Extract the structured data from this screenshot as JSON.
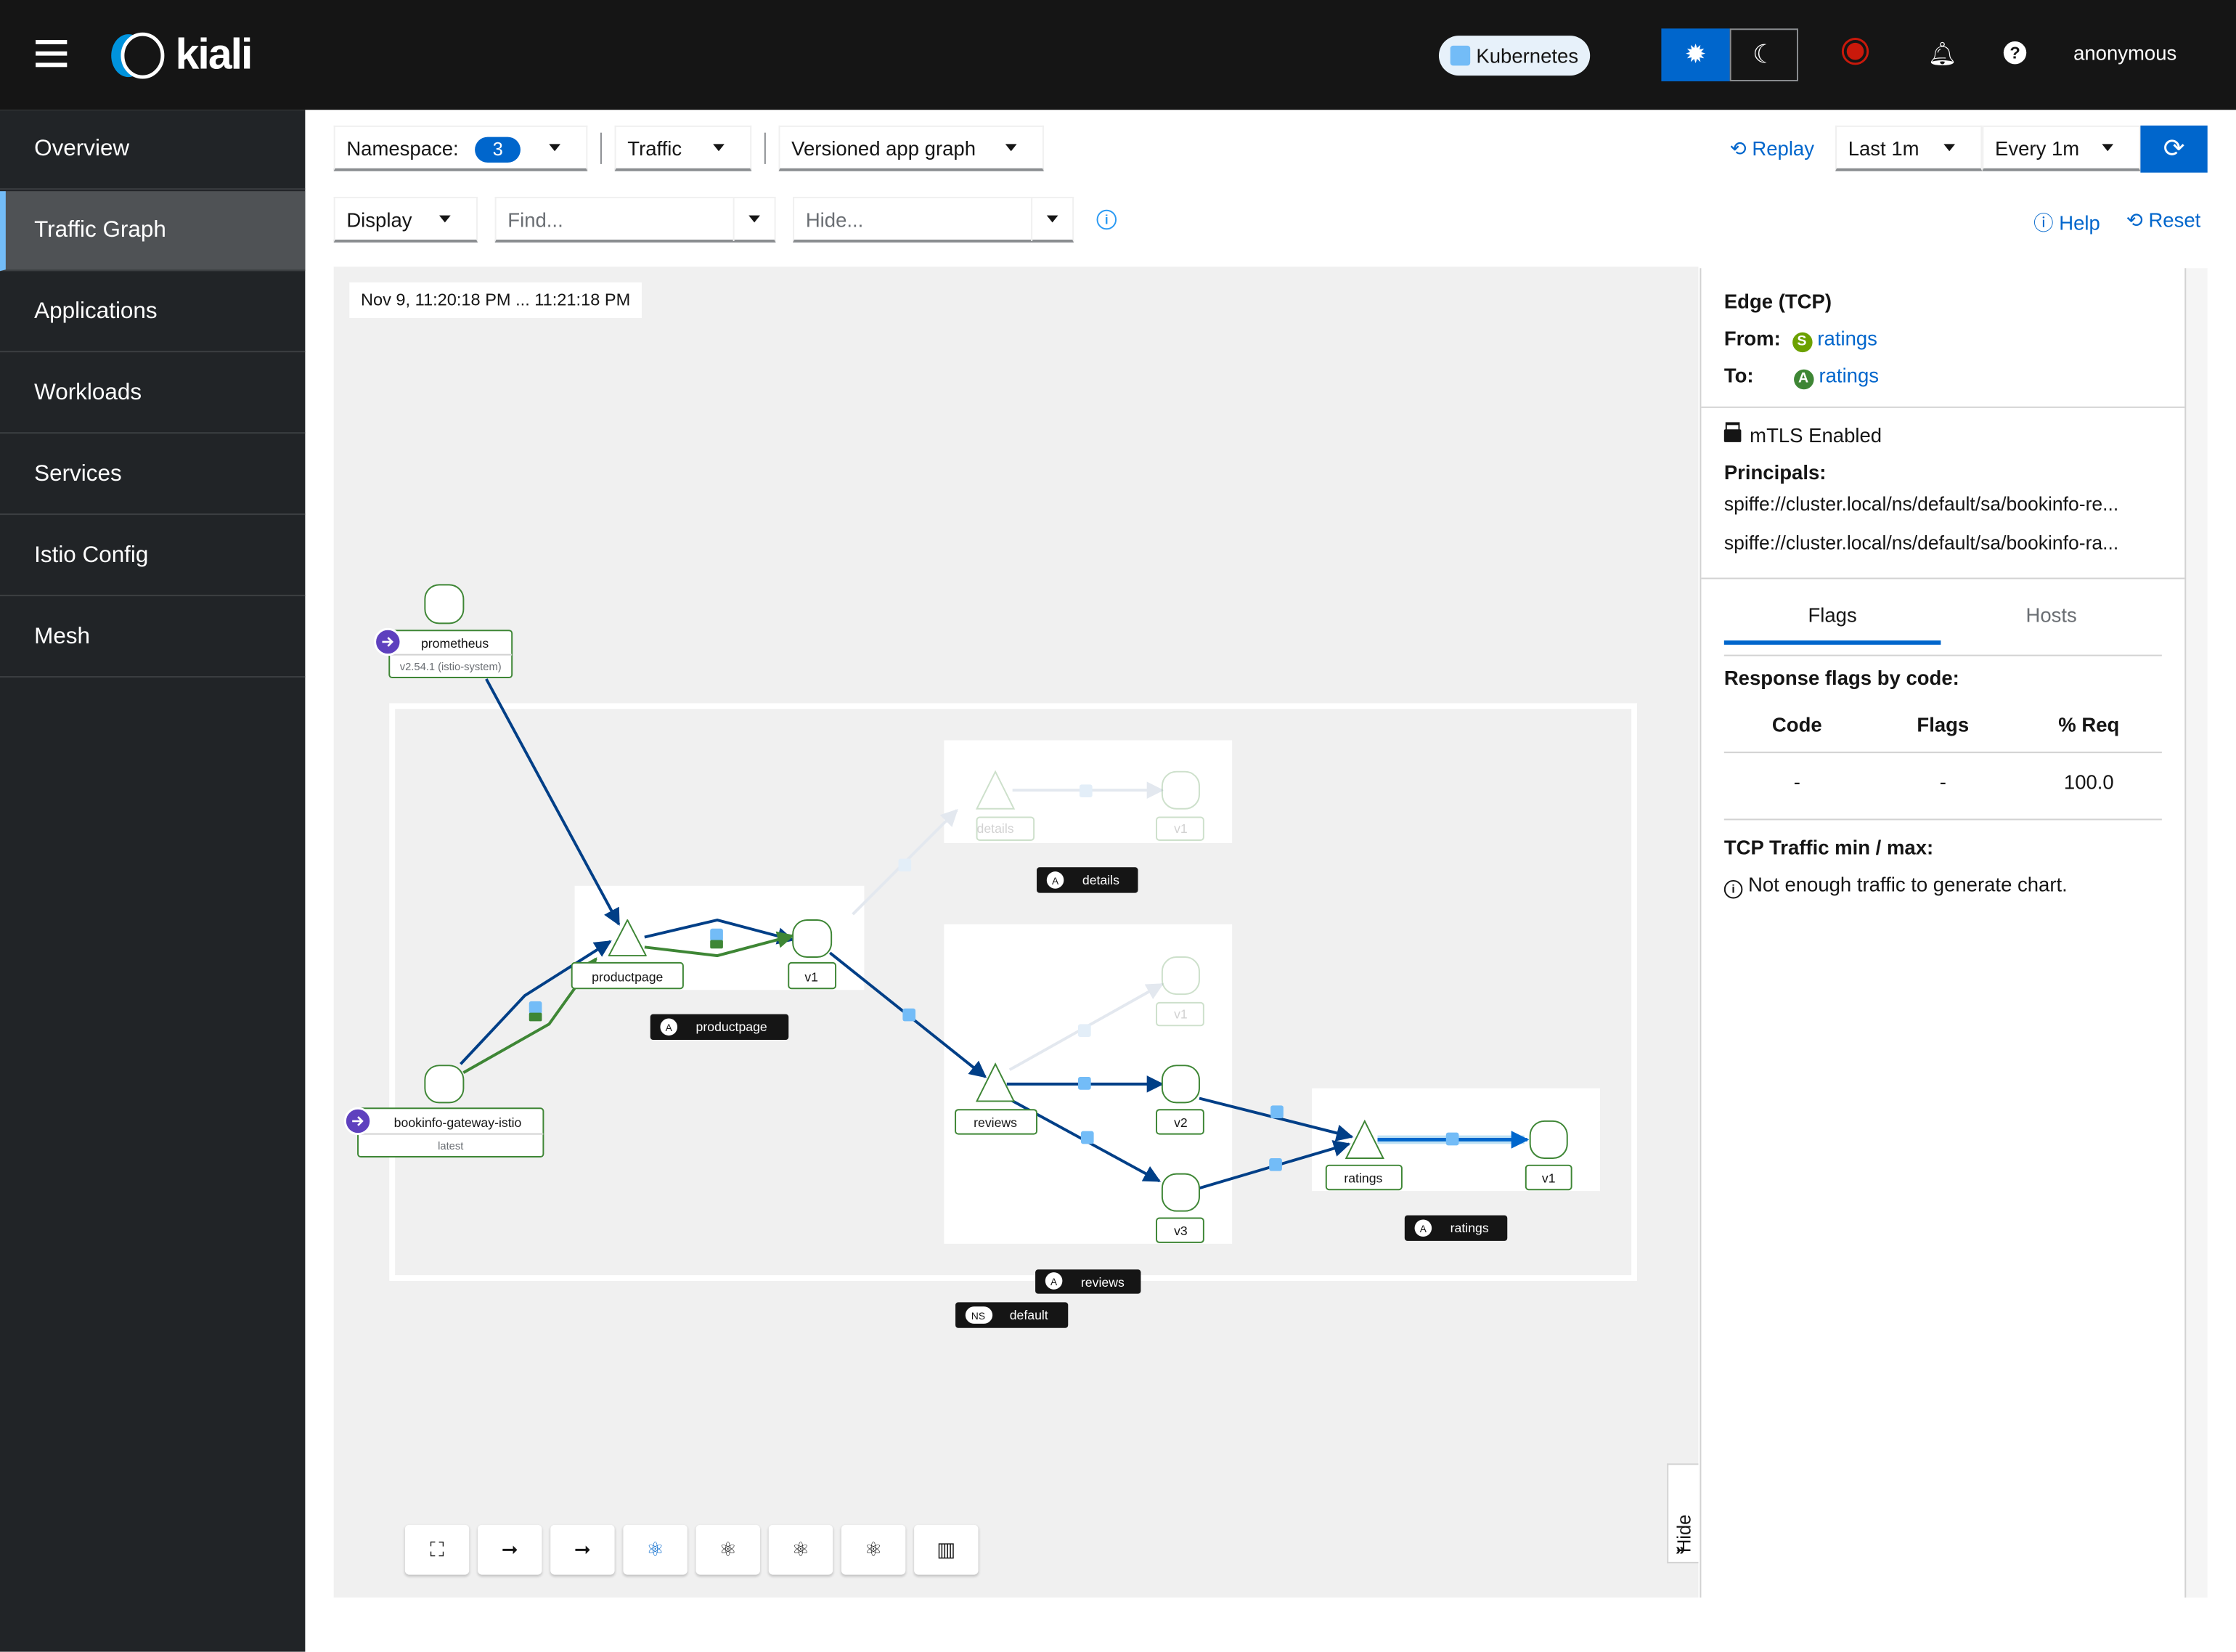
{
  "masthead": {
    "brand": "kiali",
    "cluster": "Kubernetes",
    "user": "anonymous",
    "colors": {
      "background": "#151515",
      "accent": "#0066cc"
    },
    "icons": [
      "menu-icon",
      "sun-icon",
      "moon-icon",
      "record-icon",
      "bell-icon",
      "help-icon"
    ]
  },
  "sidebar": {
    "items": [
      {
        "label": "Overview"
      },
      {
        "label": "Traffic Graph",
        "active": true
      },
      {
        "label": "Applications"
      },
      {
        "label": "Workloads"
      },
      {
        "label": "Services"
      },
      {
        "label": "Istio Config"
      },
      {
        "label": "Mesh"
      }
    ]
  },
  "toolbar": {
    "namespace_label": "Namespace:",
    "namespace_count": "3",
    "traffic": "Traffic",
    "graph_type": "Versioned app graph",
    "replay": "Replay",
    "duration": "Last 1m",
    "refresh": "Every 1m",
    "display": "Display",
    "find_placeholder": "Find...",
    "hide_placeholder": "Hide...",
    "help": "Help",
    "reset": "Reset"
  },
  "graph": {
    "timestamp": "Nov 9, 11:20:18 PM ... 11:21:18 PM",
    "nodes": {
      "prometheus": "prometheus",
      "prometheus_version": "v2.54.1 (istio-system)",
      "gateway": "bookinfo-gateway-istio",
      "gateway_version": "latest",
      "productpage": "productpage",
      "productpage_v1": "v1",
      "details": "details",
      "details_v1": "v1",
      "reviews": "reviews",
      "reviews_v1": "v1",
      "reviews_v2": "v2",
      "reviews_v3": "v3",
      "ratings": "ratings",
      "ratings_v1": "v1"
    },
    "boxes": {
      "productpage": {
        "badge": "A",
        "label": "productpage"
      },
      "details": {
        "badge": "A",
        "label": "details"
      },
      "reviews": {
        "badge": "A",
        "label": "reviews"
      },
      "ratings": {
        "badge": "A",
        "label": "ratings"
      },
      "namespace": {
        "badge": "NS",
        "label": "default"
      }
    },
    "colors": {
      "tcp_edge": "#003f87",
      "http_edge": "#3e8635",
      "selected_edge": "#0066cc",
      "mtls_lock": "#73bcf7"
    },
    "hide_tab": "Hide",
    "bottom_toolbar": [
      "expand-icon",
      "arrow-right-icon",
      "arrow-right-icon",
      "layout-default-icon",
      "layout-1-icon",
      "layout-2-icon",
      "layout-3-icon",
      "legend-map-icon"
    ]
  },
  "panel": {
    "title": "Edge (TCP)",
    "from_label": "From:",
    "from_badge": "S",
    "from_value": "ratings",
    "to_label": "To:",
    "to_badge": "A",
    "to_value": "ratings",
    "mtls": "mTLS Enabled",
    "principals_label": "Principals:",
    "principals": [
      "spiffe://cluster.local/ns/default/sa/bookinfo-re...",
      "spiffe://cluster.local/ns/default/sa/bookinfo-ra..."
    ],
    "tabs": [
      {
        "label": "Flags",
        "active": true
      },
      {
        "label": "Hosts"
      }
    ],
    "flags_title": "Response flags by code:",
    "table": {
      "headers": [
        "Code",
        "Flags",
        "% Req"
      ],
      "rows": [
        [
          "-",
          "-",
          "100.0"
        ]
      ]
    },
    "tcp_title": "TCP Traffic min / max:",
    "tcp_note": "Not enough traffic to generate chart."
  }
}
